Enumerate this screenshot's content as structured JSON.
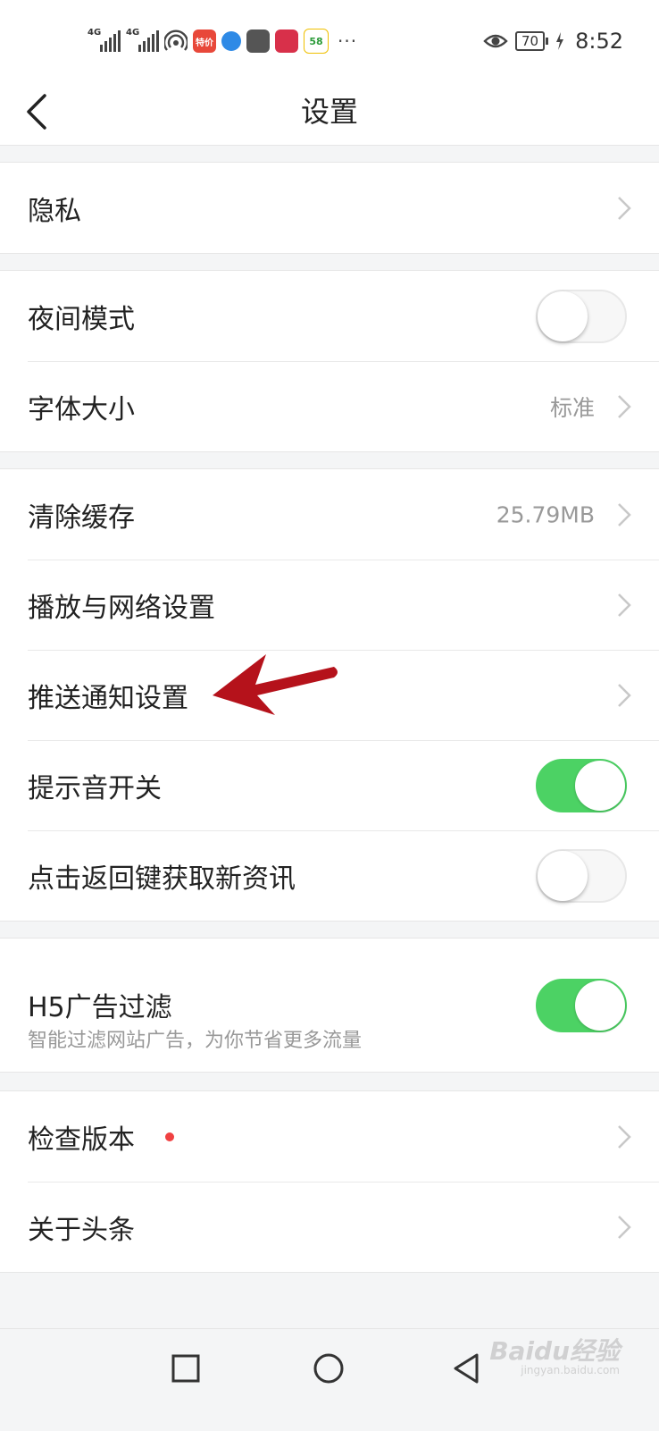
{
  "status_bar": {
    "network_1": "4G",
    "network_2": "4G",
    "app_icon_1": "特价",
    "app_icon_5": "58",
    "more": "···",
    "battery": "70",
    "time": "8:52"
  },
  "header": {
    "title": "设置"
  },
  "groups": {
    "privacy": {
      "label": "隐私"
    },
    "night_mode": {
      "label": "夜间模式",
      "enabled": false
    },
    "font_size": {
      "label": "字体大小",
      "value": "标准"
    },
    "clear_cache": {
      "label": "清除缓存",
      "value": "25.79MB"
    },
    "playback_network": {
      "label": "播放与网络设置"
    },
    "push_notification": {
      "label": "推送通知设置"
    },
    "sound_switch": {
      "label": "提示音开关",
      "enabled": true
    },
    "back_refresh": {
      "label": "点击返回键获取新资讯",
      "enabled": false
    },
    "h5_ad_filter": {
      "label": "H5广告过滤",
      "description": "智能过滤网站广告，为你节省更多流量",
      "enabled": true
    },
    "check_version": {
      "label": "检查版本",
      "has_update_dot": true
    },
    "about": {
      "label": "关于头条"
    }
  },
  "watermark": {
    "text": "Baidu经验",
    "url": "jingyan.baidu.com"
  },
  "colors": {
    "toggle_on": "#4cd264",
    "annotation_arrow": "#b5121b",
    "update_dot": "#f04142"
  }
}
